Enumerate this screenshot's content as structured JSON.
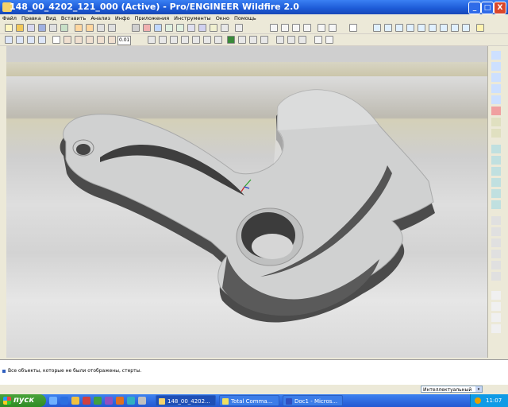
{
  "window": {
    "title": "148_00_4202_121_000 (Active) - Pro/ENGINEER Wildfire 2.0",
    "min_label": "_",
    "max_label": "□",
    "close_label": "X"
  },
  "menu": [
    "Файл",
    "Правка",
    "Вид",
    "Вставить",
    "Анализ",
    "Инфо",
    "Приложения",
    "Инструменты",
    "Окно",
    "Помощь"
  ],
  "toolbar": {
    "scale_text": "0.01"
  },
  "message_area": {
    "message": "Все объекты, которые не были отображены, стерты."
  },
  "status": {
    "filter_value": "Интеллектуальный",
    "filter_arrow": "▾"
  },
  "taskbar": {
    "start_label": "пуск",
    "tasks": [
      {
        "label": "148_00_4202...",
        "active": true
      },
      {
        "label": "Total Comma...",
        "active": false
      },
      {
        "label": "Doc1 - Micros...",
        "active": false
      }
    ],
    "clock": "11:07"
  },
  "colors": {
    "titlebar": "#1c5ad6",
    "taskbar": "#2458d2",
    "start": "#2e8b24",
    "part_top": "#cfd0d0",
    "part_side": "#4a4a4a"
  }
}
